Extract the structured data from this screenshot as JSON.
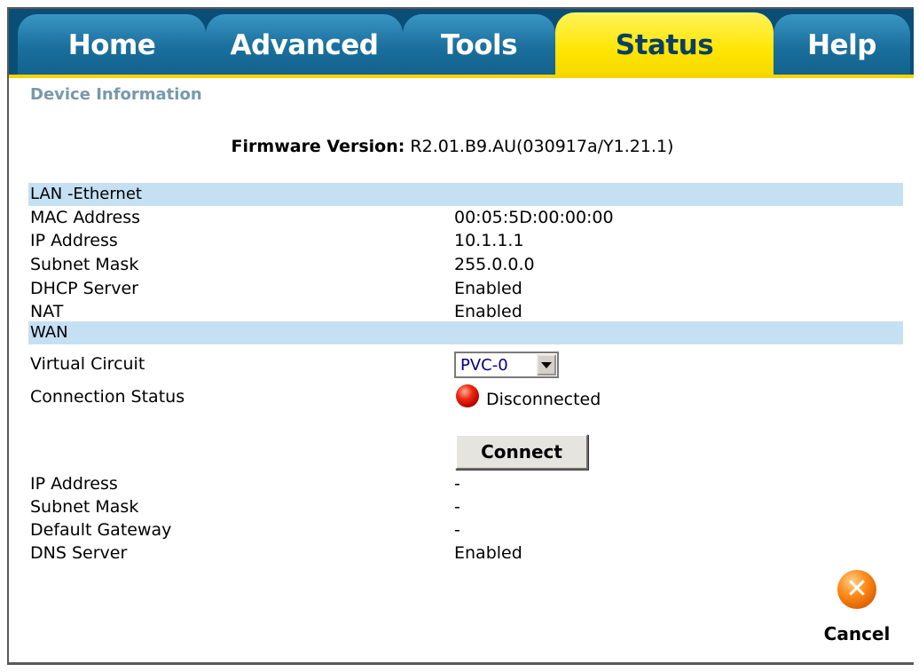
{
  "tabs": [
    {
      "label": "Home",
      "active": false
    },
    {
      "label": "Advanced",
      "active": false
    },
    {
      "label": "Tools",
      "active": false
    },
    {
      "label": "Status",
      "active": true
    },
    {
      "label": "Help",
      "active": false
    }
  ],
  "section_title": "Device Information",
  "firmware": {
    "label": "Firmware Version:",
    "value": "R2.01.B9.AU(030917a/Y1.21.1)"
  },
  "lan": {
    "header": "LAN -Ethernet",
    "rows": [
      {
        "label": "MAC Address",
        "value": "00:05:5D:00:00:00"
      },
      {
        "label": "IP Address",
        "value": "10.1.1.1"
      },
      {
        "label": "Subnet Mask",
        "value": "255.0.0.0"
      },
      {
        "label": "DHCP Server",
        "value": "Enabled"
      },
      {
        "label": "NAT",
        "value": "Enabled"
      }
    ]
  },
  "wan": {
    "header": "WAN",
    "virtual_circuit_label": "Virtual Circuit",
    "virtual_circuit_value": "PVC-0",
    "connection_status_label": "Connection Status",
    "connection_status_value": "Disconnected",
    "connect_button": "Connect",
    "rows": [
      {
        "label": "IP Address",
        "value": "-"
      },
      {
        "label": "Subnet Mask",
        "value": "-"
      },
      {
        "label": "Default Gateway",
        "value": "-"
      },
      {
        "label": "DNS Server",
        "value": "Enabled"
      }
    ]
  },
  "cancel": {
    "label": "Cancel",
    "icon": "cancel-icon"
  },
  "colors": {
    "tab_bar": "#0a4e78",
    "tab_active": "#ffe500",
    "section_band": "#c6e0f3",
    "section_title": "#7799aa",
    "status_disconnected": "#e02010"
  }
}
